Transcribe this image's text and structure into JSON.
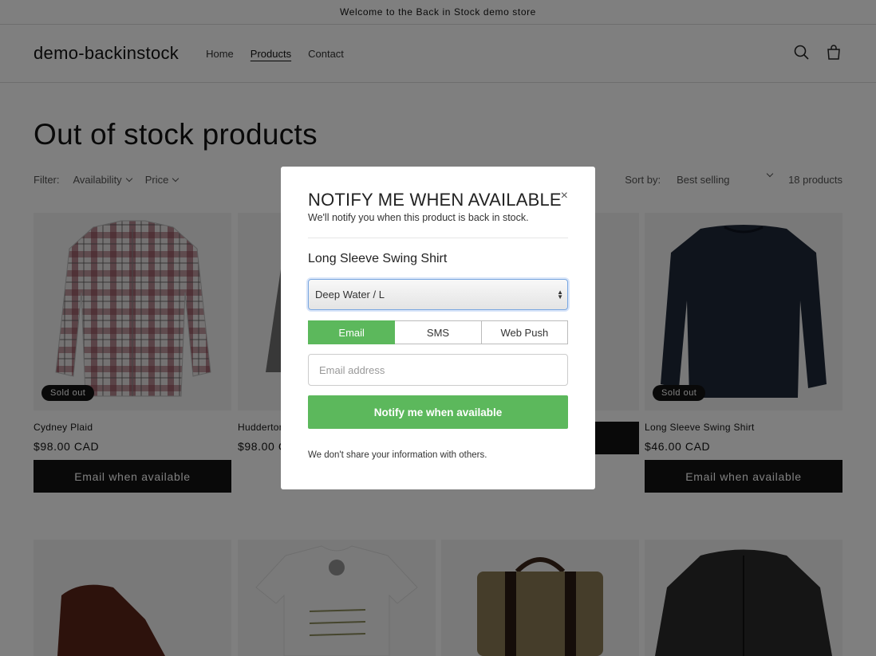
{
  "announcement": "Welcome to the Back in Stock demo store",
  "header": {
    "logo": "demo-backinstock",
    "nav": [
      {
        "label": "Home"
      },
      {
        "label": "Products"
      },
      {
        "label": "Contact"
      }
    ]
  },
  "page_title": "Out of stock products",
  "filters": {
    "label": "Filter:",
    "availability": "Availability",
    "price": "Price",
    "sort_label": "Sort by:",
    "sort_value": "Best selling",
    "count": "18 products"
  },
  "products": [
    {
      "name": "Cydney Plaid",
      "price": "$98.00 CAD",
      "badge": "Sold out",
      "button": "Email when available"
    },
    {
      "name": "Hudderton",
      "price": "$98.00 C",
      "badge": "",
      "button": ""
    },
    {
      "name": "",
      "price": "",
      "badge": "",
      "button": ""
    },
    {
      "name": "Long Sleeve Swing Shirt",
      "price": "$46.00 CAD",
      "badge": "Sold out",
      "button": "Email when available"
    }
  ],
  "modal": {
    "title": "NOTIFY ME WHEN AVAILABLE",
    "subtitle": "We'll notify you when this product is back in stock.",
    "close": "×",
    "product": "Long Sleeve Swing Shirt",
    "variant": "Deep Water / L",
    "tabs": [
      {
        "label": "Email"
      },
      {
        "label": "SMS"
      },
      {
        "label": "Web Push"
      }
    ],
    "email_placeholder": "Email address",
    "submit": "Notify me when available",
    "privacy": "We don't share your information with others."
  },
  "colors": {
    "accent_green": "#5cb85c",
    "dark": "#121212"
  }
}
